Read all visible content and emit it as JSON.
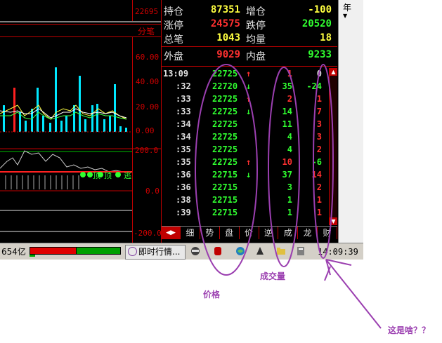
{
  "chart": {
    "price_tick_top": "22695",
    "label_fenbi": "分笔",
    "vol_ticks": [
      "60.00",
      "40.00",
      "20.00",
      "0.00"
    ],
    "osc_ticks": [
      "200.0",
      "0.0",
      "-200.0"
    ],
    "signal_labels": [
      "顶",
      "顶",
      "逃",
      "逃"
    ]
  },
  "quote": {
    "rows": [
      {
        "l1": "持仓",
        "v1": "87351",
        "c1": "#ffff40",
        "l2": "增仓",
        "v2": "-100",
        "c2": "#ffff40"
      },
      {
        "l1": "涨停",
        "v1": "24575",
        "c1": "#ff3030",
        "l2": "跌停",
        "v2": "20520",
        "c2": "#30ff30"
      },
      {
        "l1": "总笔",
        "v1": "1043",
        "c1": "#ffff40",
        "l2": "均量",
        "v2": "18",
        "c2": "#ffff40"
      },
      {
        "l1": "外盘",
        "v1": "9029",
        "c1": "#ff3030",
        "l2": "内盘",
        "v2": "9233",
        "c2": "#30ff30"
      }
    ]
  },
  "ticks": [
    {
      "time": "13:09",
      "price": "22725",
      "dir": "↑",
      "vol": "1",
      "chg": "0"
    },
    {
      "time": ":32",
      "price": "22720",
      "dir": "↓",
      "vol": "35",
      "chg": "-24"
    },
    {
      "time": ":33",
      "price": "22725",
      "dir": "↑",
      "vol": "2",
      "chg": "1"
    },
    {
      "time": ":33",
      "price": "22725",
      "dir": "↓",
      "vol": "14",
      "chg": "7"
    },
    {
      "time": ":34",
      "price": "22725",
      "dir": "",
      "vol": "11",
      "chg": "3"
    },
    {
      "time": ":34",
      "price": "22725",
      "dir": "",
      "vol": "4",
      "chg": "3"
    },
    {
      "time": ":35",
      "price": "22725",
      "dir": "",
      "vol": "4",
      "chg": "2"
    },
    {
      "time": ":35",
      "price": "22725",
      "dir": "↑",
      "vol": "10",
      "chg": "-6"
    },
    {
      "time": ":36",
      "price": "22715",
      "dir": "↓",
      "vol": "37",
      "chg": "14"
    },
    {
      "time": ":36",
      "price": "22715",
      "dir": "",
      "vol": "3",
      "chg": "2"
    },
    {
      "time": ":38",
      "price": "22715",
      "dir": "",
      "vol": "1",
      "chg": "1"
    },
    {
      "time": ":39",
      "price": "22715",
      "dir": "",
      "vol": "1",
      "chg": "1"
    }
  ],
  "tabs": [
    "细",
    "势",
    "盘",
    "价",
    "逆",
    "成",
    "龙",
    "财"
  ],
  "sidebar": {
    "label": "年"
  },
  "status": {
    "amount": "654亿",
    "feed_label": "即时行情...",
    "clock": "14:09:39"
  },
  "annotations": {
    "price": "价格",
    "volume": "成交量",
    "question": "这是啥？？"
  },
  "colors": {
    "annotation": "#9b3fb0",
    "up": "#ff3030",
    "down": "#30ff30",
    "price": "#30ff30"
  }
}
